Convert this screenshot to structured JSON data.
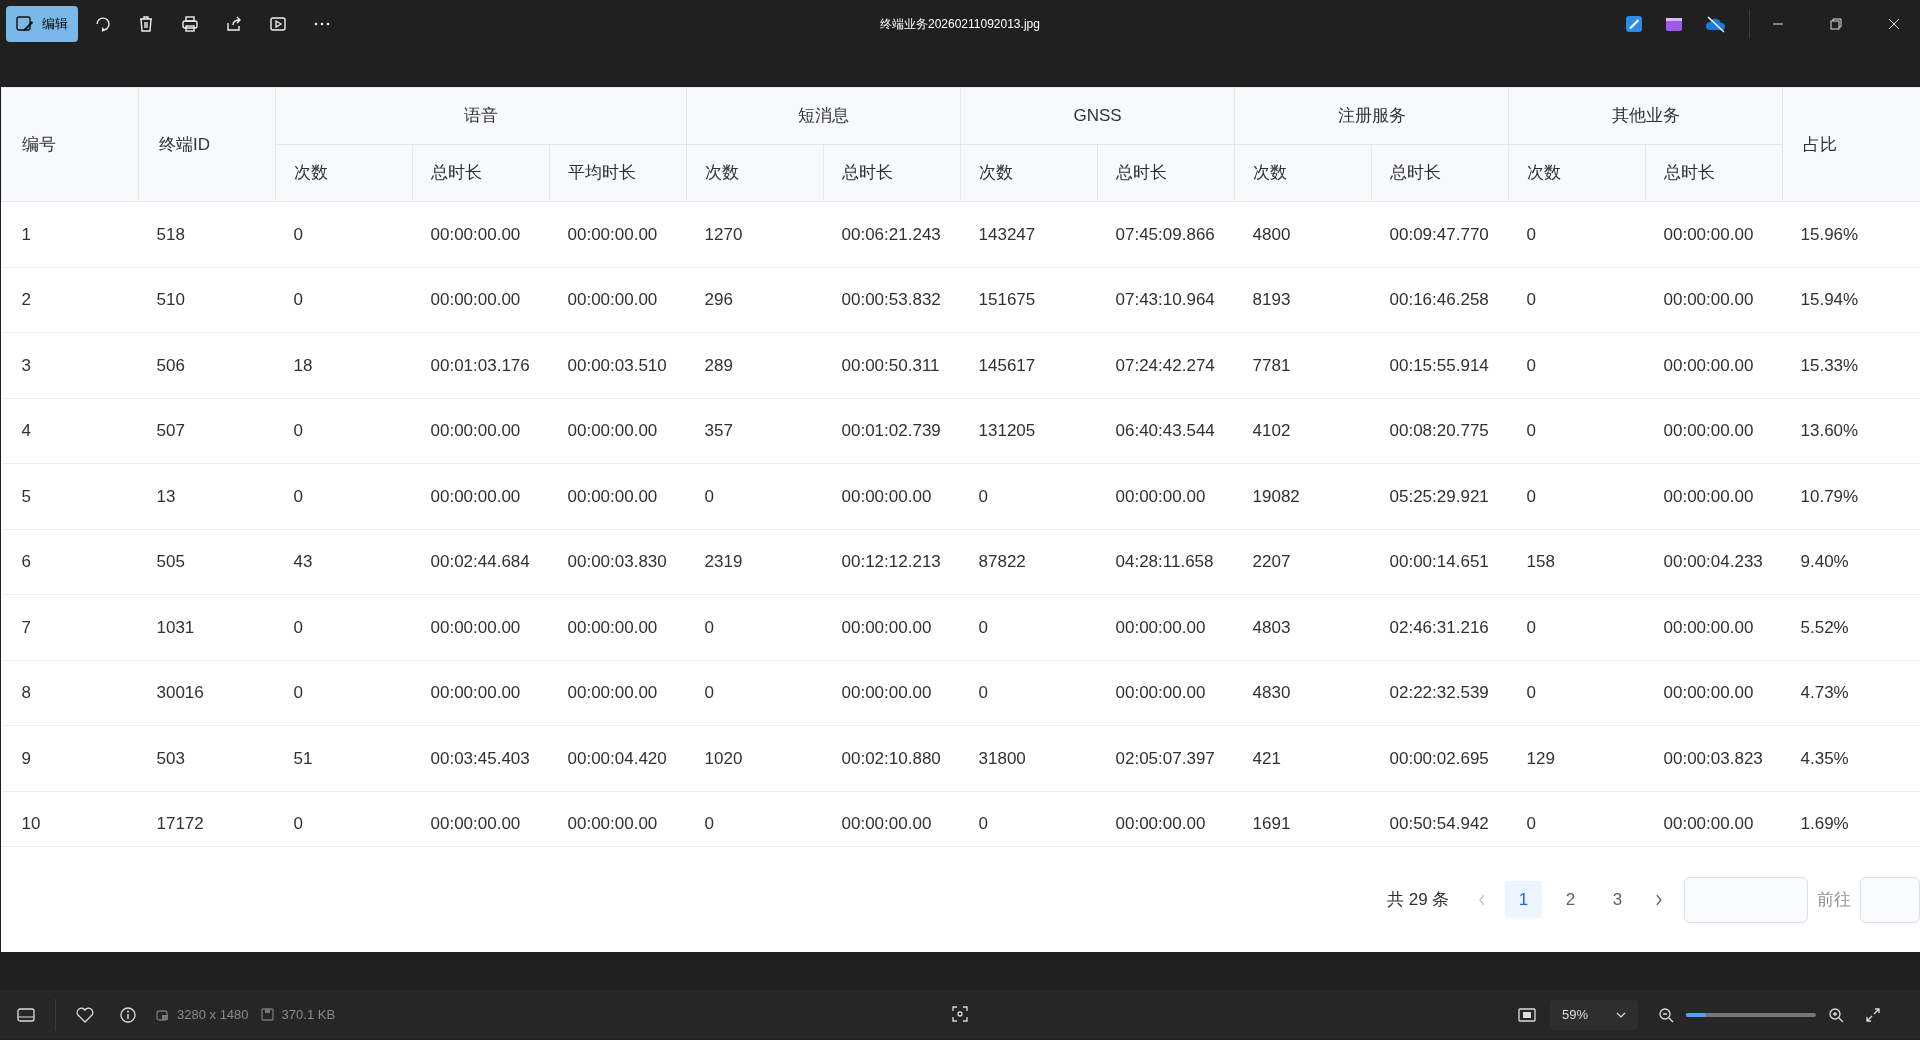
{
  "window": {
    "title": "终端业务20260211092013.jpg",
    "edit_button": "编辑"
  },
  "table": {
    "header": [
      {
        "label": "编号"
      },
      {
        "label": "终端ID"
      },
      {
        "label": "语音",
        "children": [
          "次数",
          "总时长",
          "平均时长"
        ]
      },
      {
        "label": "短消息",
        "children": [
          "次数",
          "总时长"
        ]
      },
      {
        "label": "GNSS",
        "children": [
          "次数",
          "总时长"
        ]
      },
      {
        "label": "注册服务",
        "children": [
          "次数",
          "总时长"
        ]
      },
      {
        "label": "其他业务",
        "children": [
          "次数",
          "总时长"
        ]
      },
      {
        "label": "占比"
      }
    ],
    "rows": [
      [
        "1",
        "518",
        "0",
        "00:00:00.00",
        "00:00:00.00",
        "1270",
        "00:06:21.243",
        "143247",
        "07:45:09.866",
        "4800",
        "00:09:47.770",
        "0",
        "00:00:00.00",
        "15.96%"
      ],
      [
        "2",
        "510",
        "0",
        "00:00:00.00",
        "00:00:00.00",
        "296",
        "00:00:53.832",
        "151675",
        "07:43:10.964",
        "8193",
        "00:16:46.258",
        "0",
        "00:00:00.00",
        "15.94%"
      ],
      [
        "3",
        "506",
        "18",
        "00:01:03.176",
        "00:00:03.510",
        "289",
        "00:00:50.311",
        "145617",
        "07:24:42.274",
        "7781",
        "00:15:55.914",
        "0",
        "00:00:00.00",
        "15.33%"
      ],
      [
        "4",
        "507",
        "0",
        "00:00:00.00",
        "00:00:00.00",
        "357",
        "00:01:02.739",
        "131205",
        "06:40:43.544",
        "4102",
        "00:08:20.775",
        "0",
        "00:00:00.00",
        "13.60%"
      ],
      [
        "5",
        "13",
        "0",
        "00:00:00.00",
        "00:00:00.00",
        "0",
        "00:00:00.00",
        "0",
        "00:00:00.00",
        "19082",
        "05:25:29.921",
        "0",
        "00:00:00.00",
        "10.79%"
      ],
      [
        "6",
        "505",
        "43",
        "00:02:44.684",
        "00:00:03.830",
        "2319",
        "00:12:12.213",
        "87822",
        "04:28:11.658",
        "2207",
        "00:00:14.651",
        "158",
        "00:00:04.233",
        "9.40%"
      ],
      [
        "7",
        "1031",
        "0",
        "00:00:00.00",
        "00:00:00.00",
        "0",
        "00:00:00.00",
        "0",
        "00:00:00.00",
        "4803",
        "02:46:31.216",
        "0",
        "00:00:00.00",
        "5.52%"
      ],
      [
        "8",
        "30016",
        "0",
        "00:00:00.00",
        "00:00:00.00",
        "0",
        "00:00:00.00",
        "0",
        "00:00:00.00",
        "4830",
        "02:22:32.539",
        "0",
        "00:00:00.00",
        "4.73%"
      ],
      [
        "9",
        "503",
        "51",
        "00:03:45.403",
        "00:00:04.420",
        "1020",
        "00:02:10.880",
        "31800",
        "02:05:07.397",
        "421",
        "00:00:02.695",
        "129",
        "00:00:03.823",
        "4.35%"
      ],
      [
        "10",
        "17172",
        "0",
        "00:00:00.00",
        "00:00:00.00",
        "0",
        "00:00:00.00",
        "0",
        "00:00:00.00",
        "1691",
        "00:50:54.942",
        "0",
        "00:00:00.00",
        "1.69%"
      ]
    ]
  },
  "pagination": {
    "total": "共 29 条",
    "pages": [
      {
        "label": "1",
        "selected": true
      },
      {
        "label": "2",
        "selected": false
      },
      {
        "label": "3",
        "selected": false
      }
    ],
    "goto_label": "前往"
  },
  "status_bar": {
    "dimensions": "3280 x 1480",
    "file_size": "370.1 KB",
    "zoom": "59%",
    "zoom_slider": {
      "level": 0.15
    }
  }
}
